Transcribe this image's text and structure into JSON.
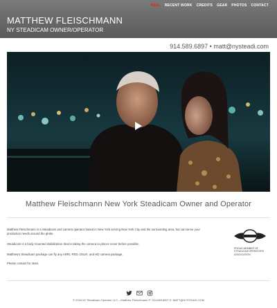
{
  "nav": {
    "items": [
      "REEL",
      "RECENT WORK",
      "CREDITS",
      "GEAR",
      "PHOTOS",
      "CONTACT"
    ],
    "active_color": "#e2231a"
  },
  "brand": {
    "name": "MATTHEW FLEISCHMANN",
    "subtitle": "NY STEADICAM OWNER/OPERATOR"
  },
  "contact_line": "914.589.6897 • matt@nysteadi.com",
  "video": {
    "play_icon": "play-icon"
  },
  "headline": "Matthew Fleischmann New York Steadicam Owner and Operator",
  "about": {
    "p1": "Matthew Fleischmann is a Steadicam and camera operator based in New York serving New York City and the surrounding area, but can serve your production needs around the globe.",
    "p2": "Steadicam is a body mounted stabilization device taking the camera to places never before possible.",
    "p3": "Matthew's Steadicam package can fly any ARRI, RED, DSLR, and HD camera package.",
    "p4": "Please contact for rates.",
    "logo_caption": "PROUD MEMBER OF STEADICAM OPERATORS ASSOCIATION"
  },
  "social": [
    "twitter-icon",
    "mail-icon",
    "instagram-icon"
  ],
  "footer": "© 2016 NY Steadicam Operator LLC – Matthew Fleischmann P: 914.589.6897 E: MATT@NYSTEADI.COM"
}
